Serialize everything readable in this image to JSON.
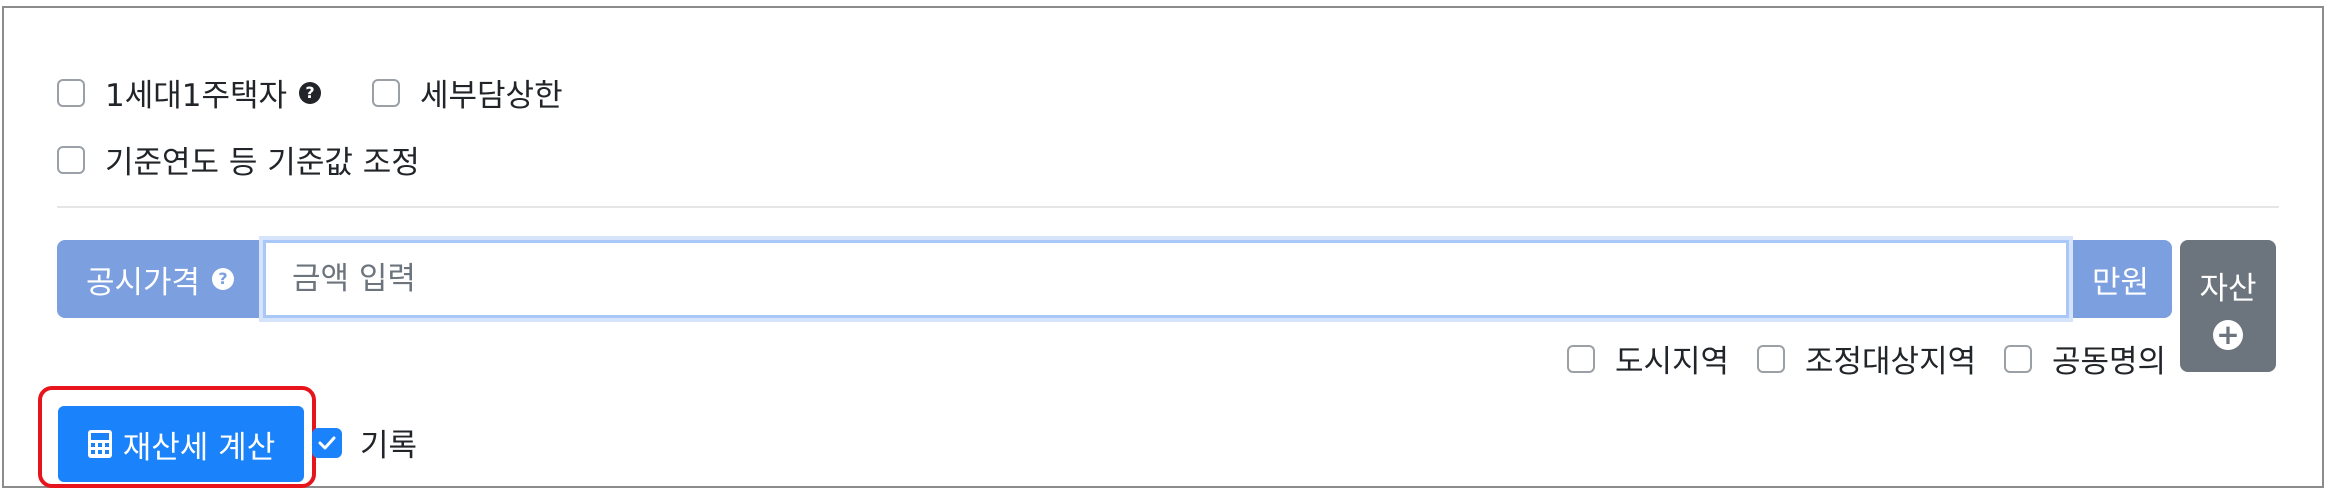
{
  "options": {
    "single_household_label": "1세대1주택자",
    "tax_cap_label": "세부담상한",
    "adjust_base_label": "기준연도 등 기준값 조정"
  },
  "price_input": {
    "prefix_label": "공시가격",
    "placeholder": "금액 입력",
    "value": "",
    "unit": "만원"
  },
  "region_options": {
    "urban_label": "도시지역",
    "regulated_label": "조정대상지역",
    "joint_label": "공동명의"
  },
  "asset_button": {
    "label": "자산"
  },
  "calc_button": {
    "label": "재산세 계산"
  },
  "record": {
    "label": "기록",
    "checked": true
  },
  "colors": {
    "primary": "#1a82fb",
    "addon": "#7c9fe0",
    "secondary": "#6c757d",
    "highlight": "#e8141c"
  }
}
